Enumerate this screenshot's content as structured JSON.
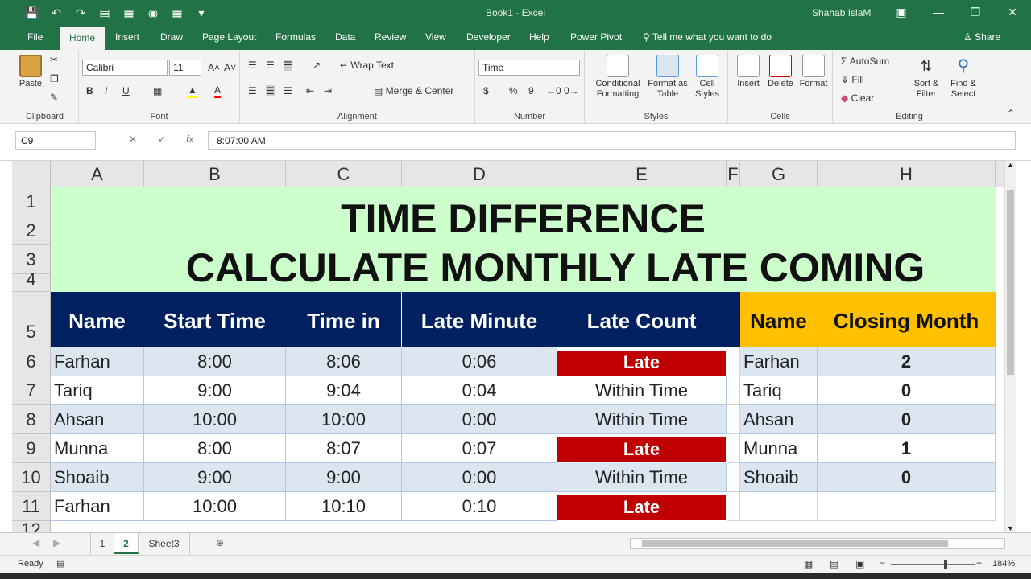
{
  "window": {
    "title": "Book1  -  Excel",
    "user": "Shahab IslaM",
    "qat_icons": [
      "save-icon",
      "undo-icon",
      "redo-icon",
      "form-icon",
      "table-icon",
      "camera-icon",
      "calculator-icon",
      "customize-icon"
    ]
  },
  "ribbon_tabs": [
    "File",
    "Home",
    "Insert",
    "Draw",
    "Page Layout",
    "Formulas",
    "Data",
    "Review",
    "View",
    "Developer",
    "Help",
    "Power Pivot"
  ],
  "tell_me": "Tell me what you want to do",
  "share": "Share",
  "ribbon": {
    "clipboard": {
      "paste": "Paste",
      "label": "Clipboard"
    },
    "font": {
      "name": "Calibri",
      "size": "11",
      "bold": "B",
      "italic": "I",
      "underline": "U",
      "label": "Font"
    },
    "alignment": {
      "wrap": "Wrap Text",
      "merge": "Merge & Center",
      "label": "Alignment"
    },
    "number": {
      "format": "Time",
      "currency": "$",
      "percent": "%",
      "comma": "9",
      "label": "Number"
    },
    "styles": {
      "conditional": "Conditional",
      "conditional2": "Formatting",
      "format_table": "Format as",
      "format_table2": "Table",
      "cell_styles": "Cell",
      "cell_styles2": "Styles",
      "label": "Styles"
    },
    "cells": {
      "insert": "Insert",
      "delete": "Delete",
      "format": "Format",
      "label": "Cells"
    },
    "editing": {
      "autosum": "AutoSum",
      "fill": "Fill",
      "clear": "Clear",
      "sort": "Sort &",
      "sort2": "Filter",
      "find": "Find &",
      "find2": "Select",
      "label": "Editing"
    }
  },
  "formula_bar": {
    "name_box": "C9",
    "fx": "fx",
    "formula": "8:07:00 AM"
  },
  "columns": [
    "A",
    "B",
    "C",
    "D",
    "E",
    "F",
    "G",
    "H"
  ],
  "rows": [
    "1",
    "2",
    "3",
    "4",
    "5",
    "6",
    "7",
    "8",
    "9",
    "10",
    "11",
    "12"
  ],
  "sheet": {
    "title1": "TIME DIFFERENCE",
    "title2": "CALCULATE MONTHLY LATE COMING",
    "headers": [
      "Name",
      "Start Time",
      "Time in",
      "Late Minute",
      "Late Count"
    ],
    "summary_headers": [
      "Name",
      "Closing Month"
    ],
    "data": [
      [
        "Farhan",
        "8:00",
        "8:06",
        "0:06",
        "Late"
      ],
      [
        "Tariq",
        "9:00",
        "9:04",
        "0:04",
        "Within Time"
      ],
      [
        "Ahsan",
        "10:00",
        "10:00",
        "0:00",
        "Within Time"
      ],
      [
        "Munna",
        "8:00",
        "8:07",
        "0:07",
        "Late"
      ],
      [
        "Shoaib",
        "9:00",
        "9:00",
        "0:00",
        "Within Time"
      ],
      [
        "Farhan",
        "10:00",
        "10:10",
        "0:10",
        "Late"
      ]
    ],
    "summary": [
      [
        "Farhan",
        "2"
      ],
      [
        "Tariq",
        "0"
      ],
      [
        "Ahsan",
        "0"
      ],
      [
        "Munna",
        "1"
      ],
      [
        "Shoaib",
        "0"
      ]
    ]
  },
  "sheet_tabs": [
    "1",
    "2",
    "Sheet3"
  ],
  "active_sheet": "2",
  "status": {
    "ready": "Ready",
    "zoom": "184%"
  },
  "colors": {
    "excel_green": "#217346",
    "title_bg": "#ccffcc",
    "header_navy": "#002060",
    "header_amber": "#ffc000",
    "late_red": "#c00000",
    "band_blue": "#dce6f1"
  }
}
